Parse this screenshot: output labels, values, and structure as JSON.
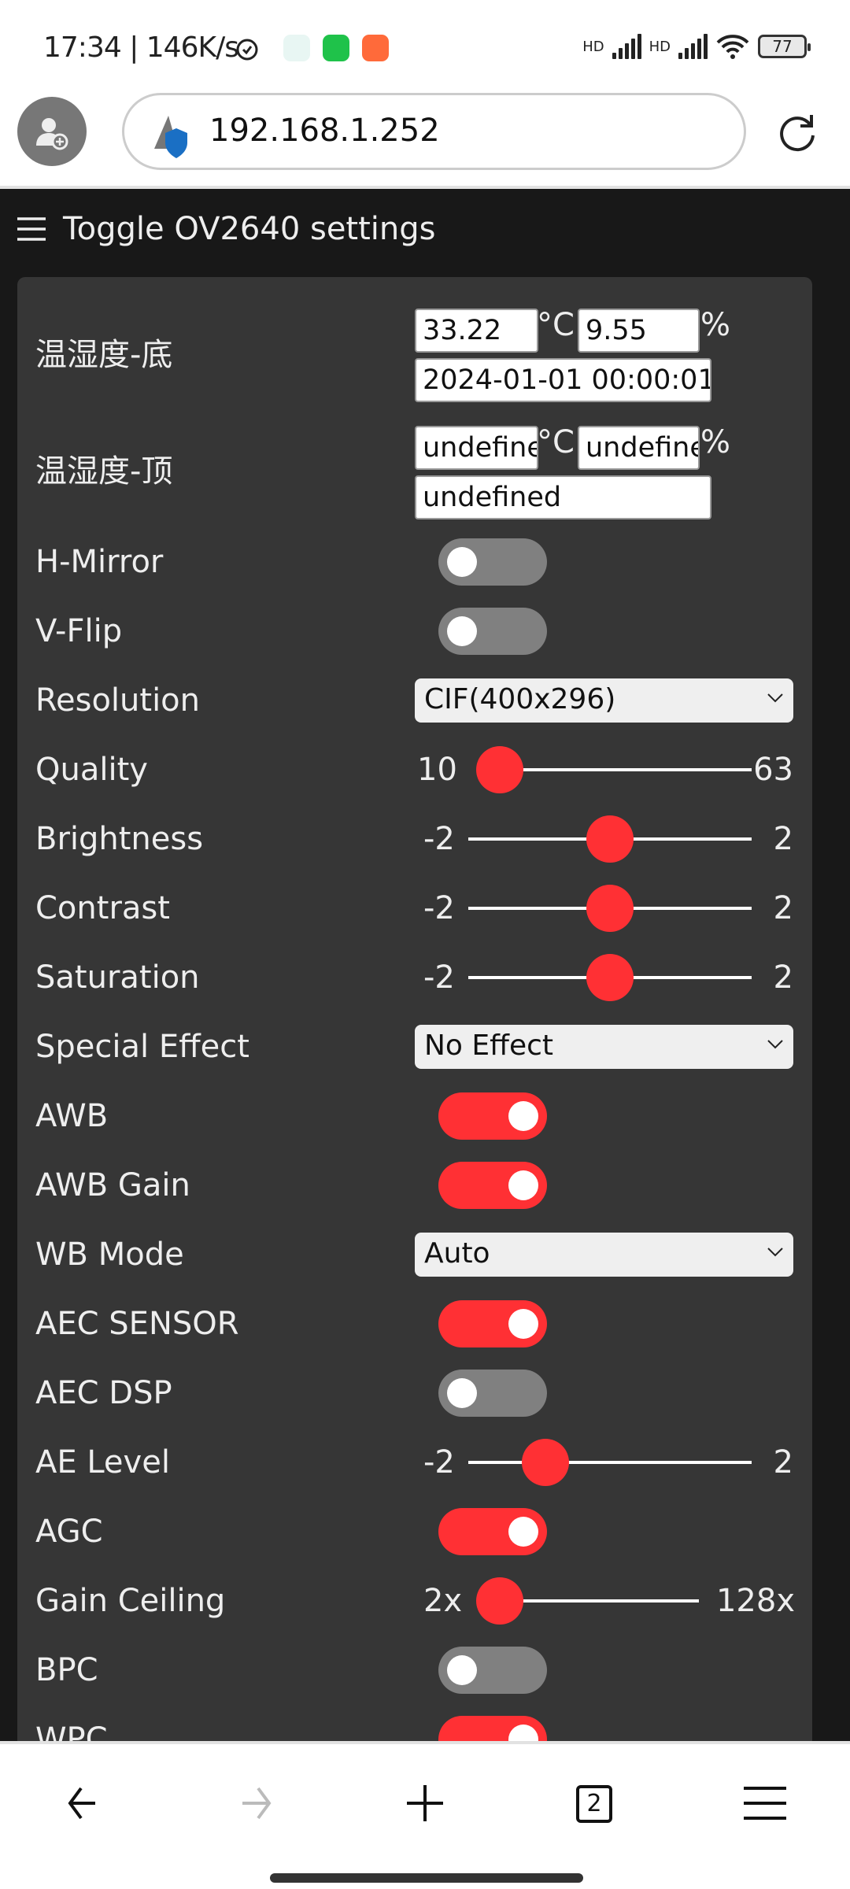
{
  "status_bar": {
    "text": "17:34 | 146K/s",
    "battery": "77",
    "signal_labels": [
      "HD",
      "HD"
    ]
  },
  "browser": {
    "url": "192.168.1.252",
    "tab_count": "2"
  },
  "page": {
    "title": "Toggle OV2640 settings",
    "sensor_bottom": {
      "label": "温湿度-底",
      "temperature": "33.22",
      "temp_unit": "°C",
      "humidity": "9.55",
      "hum_unit": "%",
      "time": "2024-01-01 00:00:01"
    },
    "sensor_top": {
      "label": "温湿度-顶",
      "temperature": "undefined",
      "temp_unit": "°C",
      "humidity": "undefined",
      "hum_unit": "%",
      "time": "undefined"
    },
    "rows": [
      {
        "type": "toggle",
        "label": "H-Mirror",
        "on": false
      },
      {
        "type": "toggle",
        "label": "V-Flip",
        "on": false
      },
      {
        "type": "select",
        "label": "Resolution",
        "value": "CIF(400x296)"
      },
      {
        "type": "slider",
        "label": "Quality",
        "min_label": "10",
        "max_label": "63",
        "min": 10,
        "max": 63,
        "value": 10
      },
      {
        "type": "slider",
        "label": "Brightness",
        "min_label": "-2",
        "max_label": "2",
        "min": -2,
        "max": 2,
        "value": 0
      },
      {
        "type": "slider",
        "label": "Contrast",
        "min_label": "-2",
        "max_label": "2",
        "min": -2,
        "max": 2,
        "value": 0
      },
      {
        "type": "slider",
        "label": "Saturation",
        "min_label": "-2",
        "max_label": "2",
        "min": -2,
        "max": 2,
        "value": 0
      },
      {
        "type": "select",
        "label": "Special Effect",
        "value": "No Effect"
      },
      {
        "type": "toggle",
        "label": "AWB",
        "on": true
      },
      {
        "type": "toggle",
        "label": "AWB Gain",
        "on": true
      },
      {
        "type": "select",
        "label": "WB Mode",
        "value": "Auto"
      },
      {
        "type": "toggle",
        "label": "AEC SENSOR",
        "on": true
      },
      {
        "type": "toggle",
        "label": "AEC DSP",
        "on": false
      },
      {
        "type": "slider",
        "label": "AE Level",
        "min_label": "-2",
        "max_label": "2",
        "min": -2,
        "max": 2,
        "value": -1
      },
      {
        "type": "toggle",
        "label": "AGC",
        "on": true
      },
      {
        "type": "slider",
        "label": "Gain Ceiling",
        "min_label": "2x",
        "max_label": "128x",
        "min": 0,
        "max": 6,
        "value": 0
      },
      {
        "type": "toggle",
        "label": "BPC",
        "on": false
      },
      {
        "type": "toggle",
        "label": "WPC",
        "on": true
      }
    ]
  },
  "colors": {
    "accent": "#ff3034",
    "toggle_off": "#808080",
    "panel": "#363636",
    "page_bg": "#181818"
  }
}
